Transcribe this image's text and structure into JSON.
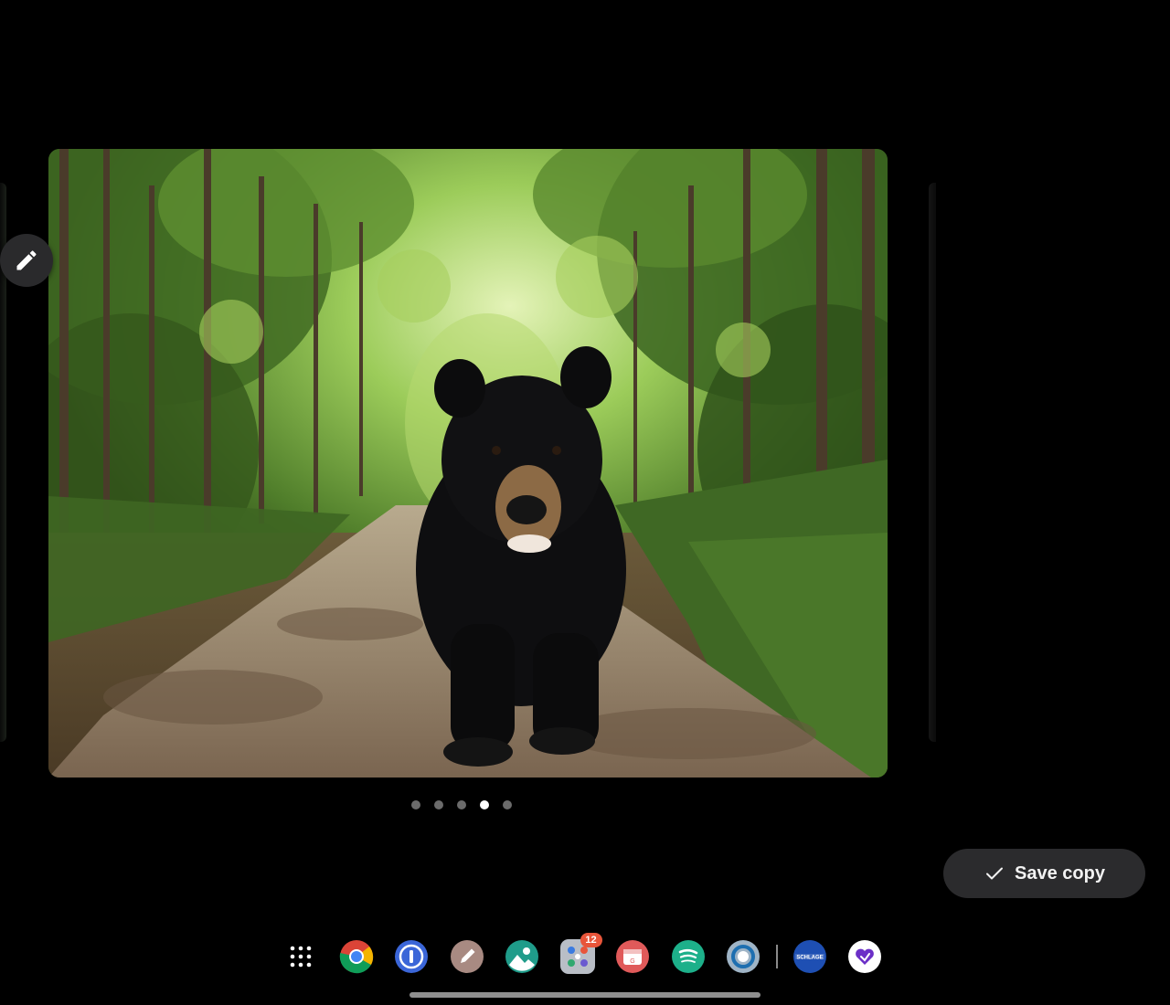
{
  "viewer": {
    "photo_subject": "black-bear-on-forest-trail",
    "pager": {
      "total": 5,
      "active_index": 4
    },
    "edit_icon": "pencil-icon",
    "save_button": {
      "label": "Save copy",
      "icon": "checkmark-icon"
    }
  },
  "taskbar": {
    "apps": [
      {
        "name": "app-drawer",
        "icon": "grid-dots-icon"
      },
      {
        "name": "chrome",
        "icon": "chrome-icon"
      },
      {
        "name": "1password",
        "icon": "1password-icon"
      },
      {
        "name": "pen-app",
        "icon": "pen-icon"
      },
      {
        "name": "gallery",
        "icon": "gallery-icon"
      },
      {
        "name": "folder",
        "icon": "folder-icon",
        "badge": "12"
      },
      {
        "name": "gmail-style-app",
        "icon": "mail-icon"
      },
      {
        "name": "spotify",
        "icon": "spotify-icon"
      },
      {
        "name": "camera-ring-app",
        "icon": "ring-icon"
      },
      {
        "name": "schlage",
        "icon": "schlage-icon",
        "text": "SCHLAGE"
      },
      {
        "name": "heart-app",
        "icon": "heart-icon"
      }
    ]
  },
  "colors": {
    "background": "#000000",
    "save_button_bg": "#2b2b2d",
    "badge": "#e8553a",
    "active_dot": "#ffffff",
    "inactive_dot": "#6b6b6b"
  }
}
